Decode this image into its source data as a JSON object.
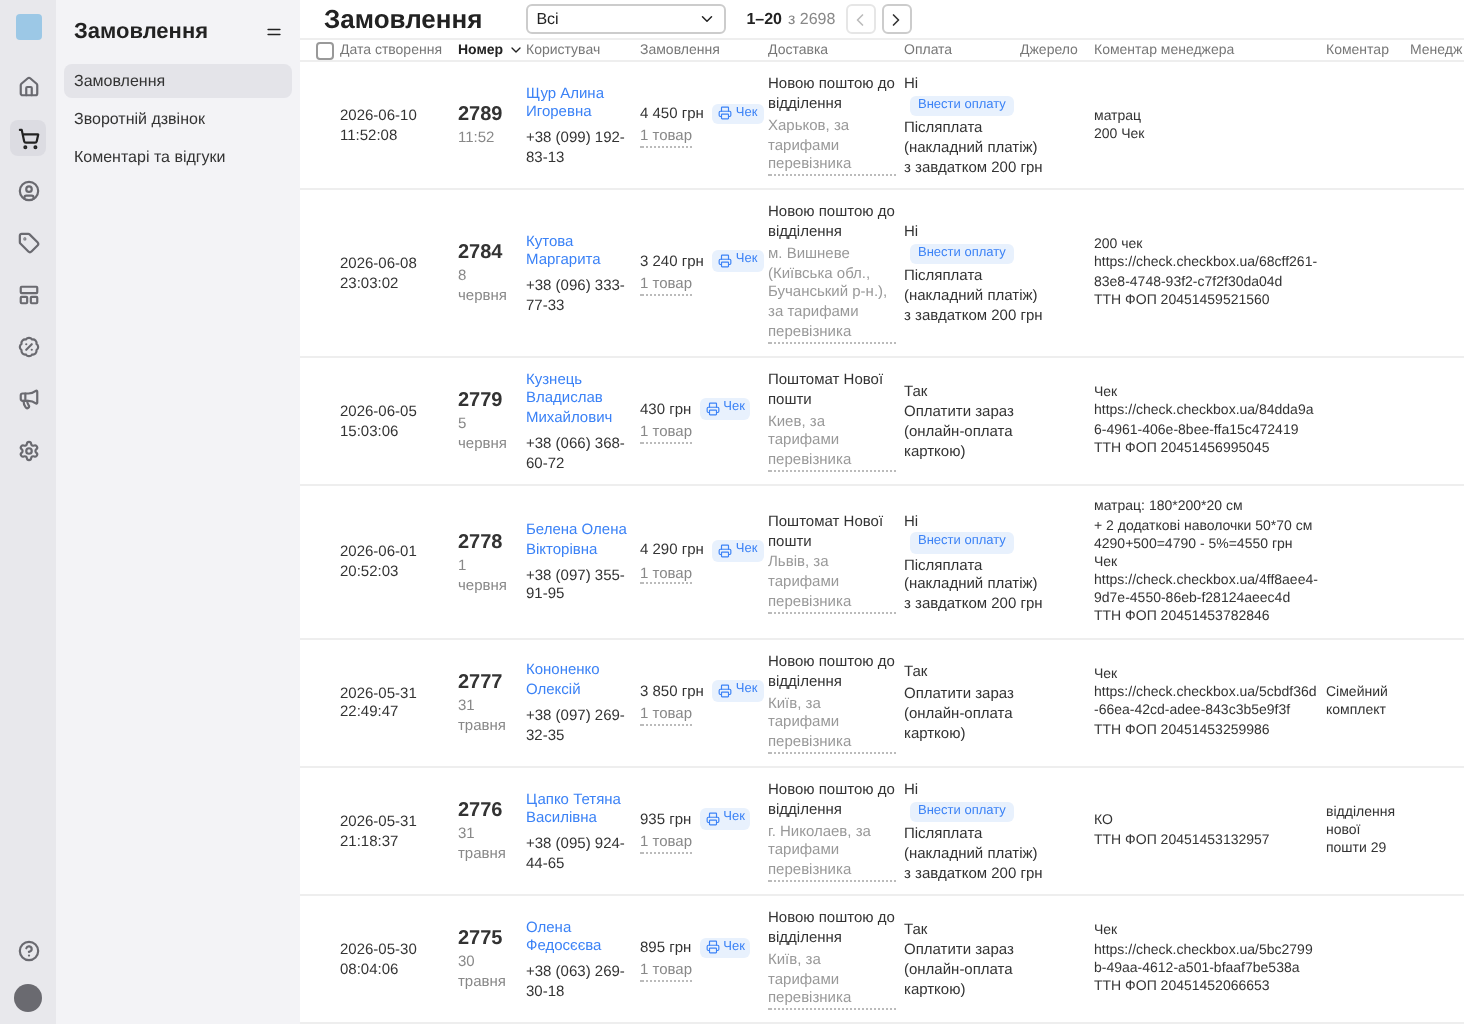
{
  "rail": {
    "items": [
      {
        "selected": false
      },
      {
        "selected": true
      },
      {
        "selected": false
      },
      {
        "selected": false
      },
      {
        "selected": false
      },
      {
        "selected": false
      },
      {
        "selected": false
      },
      {
        "selected": false
      }
    ]
  },
  "sidebar": {
    "title": "Замовлення",
    "items": [
      {
        "label": "Замовлення",
        "selected": true
      },
      {
        "label": "Зворотній дзвінок",
        "selected": false
      },
      {
        "label": "Коментарі та відгуки",
        "selected": false
      }
    ]
  },
  "header": {
    "title": "Замовлення",
    "filter": "Всі",
    "range": "1–20",
    "total": "з 2698",
    "prev_disabled": true,
    "next_disabled": false
  },
  "table": {
    "select_all": {
      "checked": false
    },
    "columns": [
      {
        "label": "Дата створення",
        "sorted": false
      },
      {
        "label": "Номер",
        "sorted": true
      },
      {
        "label": "Користувач",
        "sorted": false
      },
      {
        "label": "Замовлення",
        "sorted": false
      },
      {
        "label": "Доставка",
        "sorted": false
      },
      {
        "label": "Оплата",
        "sorted": false
      },
      {
        "label": "Джерело",
        "sorted": false
      },
      {
        "label": "Коментар менеджера",
        "sorted": false
      },
      {
        "label": "Коментар",
        "sorted": false
      },
      {
        "label": "Менедж",
        "sorted": false
      }
    ],
    "rows": [
      {
        "date": "2026-06-10",
        "time": "11:52:08",
        "number": "2789",
        "number_sub": "11:52",
        "name": "Щур Алина Игоревна",
        "phone": "+38 (099) 192-83-13",
        "amount": "4 450 грн",
        "receipt": "Чек",
        "items": "1 товар",
        "delivery": "Новою поштою до відділення",
        "city": "Харьков, за тарифами перевізника",
        "pay_status": "Ні",
        "pay_action": "Внести оплату",
        "pay_method": "Післяплата (накладний платіж) з завдатком 200 грн",
        "manager_comment": "матрац\n200 Чек"
      },
      {
        "date": "2026-06-08",
        "time": "23:03:02",
        "number": "2784",
        "number_sub": "8 червня",
        "name": "Кутова Маргарита",
        "phone": "+38 (096) 333-77-33",
        "amount": "3 240 грн",
        "receipt": "Чек",
        "items": "1 товар",
        "delivery": "Новою поштою до відділення",
        "city": "м. Вишневе (Київська обл., Бучанський р-н.), за тарифами перевізника",
        "pay_status": "Ні",
        "pay_action": "Внести оплату",
        "pay_method": "Післяплата (накладний платіж) з завдатком 200 грн",
        "manager_comment": "200 чек\nhttps://check.checkbox.ua/68cff261-83e8-4748-93f2-c7f2f30da04d\nТТН ФОП 20451459521560"
      },
      {
        "date": "2026-06-05",
        "time": "15:03:06",
        "number": "2779",
        "number_sub": "5 червня",
        "name": "Кузнець Владислав Михайлович",
        "phone": "+38 (066) 368-60-72",
        "amount": "430 грн",
        "receipt": "Чек",
        "items": "1 товар",
        "delivery": "Поштомат Нової пошти",
        "city": "Киев, за тарифами перевізника",
        "pay_status": "Так",
        "pay_method": "Оплатити зараз (онлайн-оплата карткою)",
        "manager_comment": "Чек\nhttps://check.checkbox.ua/84dda9a6-4961-406e-8bee-ffa15c472419\nТТН ФОП 20451456995045"
      },
      {
        "date": "2026-06-01",
        "time": "20:52:03",
        "number": "2778",
        "number_sub": "1 червня",
        "name": "Белена Олена Вікторівна",
        "phone": "+38 (097) 355-91-95",
        "amount": "4 290 грн",
        "receipt": "Чек",
        "items": "1 товар",
        "delivery": "Поштомат Нової пошти",
        "city": "Львів, за тарифами перевізника",
        "pay_status": "Ні",
        "pay_action": "Внести оплату",
        "pay_method": "Післяплата (накладний платіж) з завдатком 200 грн",
        "manager_comment": "матрац: 180*200*20 см\n+ 2 додаткові наволочки 50*70 см\n4290+500=4790 - 5%=4550 грн Чек\nhttps://check.checkbox.ua/4ff8aee4-9d7e-4550-86eb-f28124aeec4d\nТТН ФОП 20451453782846"
      },
      {
        "date": "2026-05-31",
        "time": "22:49:47",
        "number": "2777",
        "number_sub": "31 травня",
        "name": "Кононенко Олексій",
        "phone": "+38 (097) 269-32-35",
        "amount": "3 850 грн",
        "receipt": "Чек",
        "items": "1 товар",
        "delivery": "Новою поштою до відділення",
        "city": "Київ, за тарифами перевізника",
        "pay_status": "Так",
        "pay_method": "Оплатити зараз (онлайн-оплата карткою)",
        "manager_comment": "Чек\nhttps://check.checkbox.ua/5cbdf36d-66ea-42cd-adee-843c3b5e9f3f\nТТН ФОП 20451453259986",
        "comment": "Сімейний комплект"
      },
      {
        "date": "2026-05-31",
        "time": "21:18:37",
        "number": "2776",
        "number_sub": "31 травня",
        "name": "Цапко Тетяна Василівна",
        "phone": "+38 (095) 924-44-65",
        "amount": "935 грн",
        "receipt": "Чек",
        "items": "1 товар",
        "delivery": "Новою поштою до відділення",
        "city": "г. Николаев, за тарифами перевізника",
        "pay_status": "Ні",
        "pay_action": "Внести оплату",
        "pay_method": "Післяплата (накладний платіж) з завдатком 200 грн",
        "manager_comment": "КО\nТТН ФОП 20451453132957",
        "comment": "відділення нової пошти 29"
      },
      {
        "date": "2026-05-30",
        "time": "08:04:06",
        "number": "2775",
        "number_sub": "30 травня",
        "name": "Олена Федосєєва",
        "phone": "+38 (063) 269-30-18",
        "amount": "895 грн",
        "receipt": "Чек",
        "items": "1 товар",
        "delivery": "Новою поштою до відділення",
        "city": "Київ, за тарифами перевізника",
        "pay_status": "Так",
        "pay_method": "Оплатити зараз (онлайн-оплата карткою)",
        "manager_comment": "Чек\nhttps://check.checkbox.ua/5bc2799b-49aa-4612-a501-bfaaf7be538a\nТТН ФОП 20451452066653"
      }
    ]
  }
}
